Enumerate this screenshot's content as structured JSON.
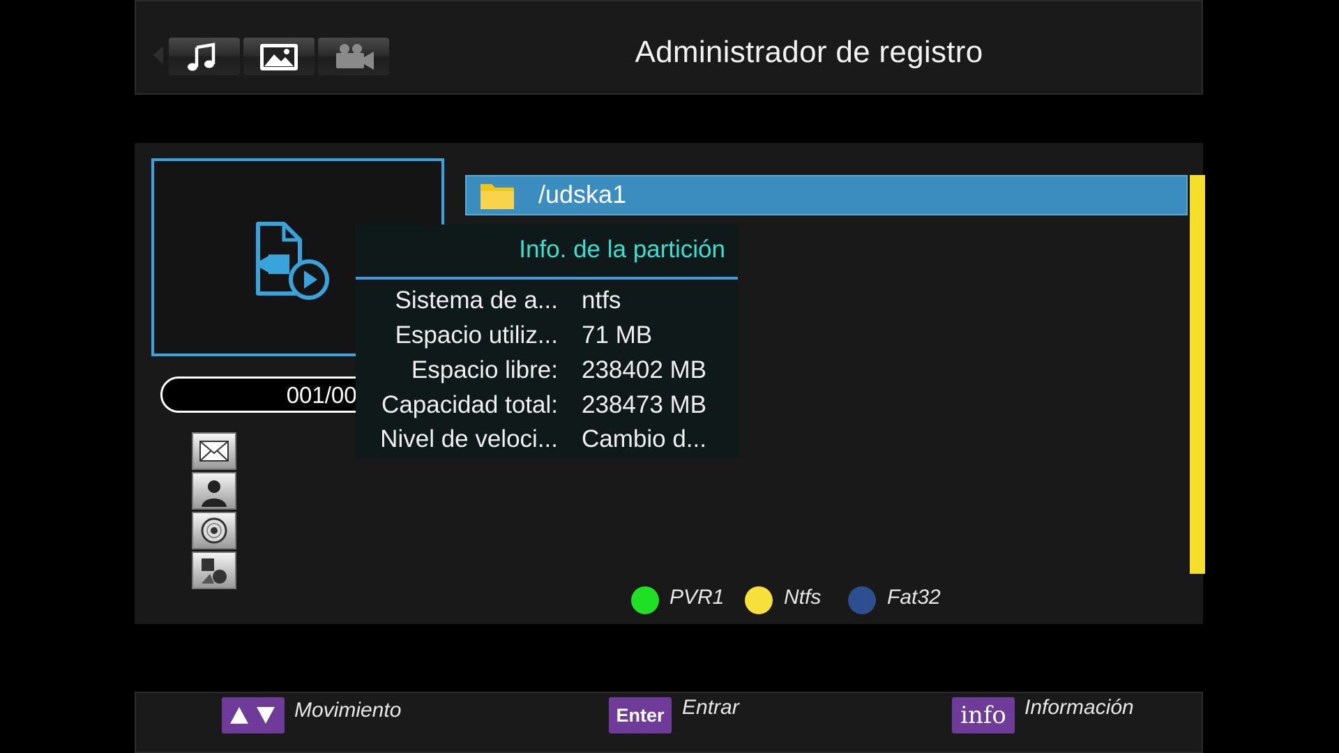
{
  "header": {
    "title": "Administrador de registro",
    "tabs": [
      {
        "name": "music",
        "icon": "music-note-icon"
      },
      {
        "name": "photo",
        "icon": "image-icon"
      },
      {
        "name": "video",
        "icon": "video-camera-icon"
      }
    ]
  },
  "preview": {
    "icon": "video-file-icon",
    "counter": "001/001"
  },
  "side_icons": [
    "mail-icon",
    "person-icon",
    "disc-icon",
    "shapes-icon"
  ],
  "file_list": {
    "items": [
      {
        "name": "/udska1",
        "icon": "folder-icon",
        "selected": true
      }
    ]
  },
  "partition_info": {
    "title": "Info. de la partición",
    "rows": [
      {
        "label": "Sistema de a...",
        "value": "ntfs"
      },
      {
        "label": "Espacio utiliz...",
        "value": "71 MB"
      },
      {
        "label": "Espacio libre:",
        "value": "238402 MB"
      },
      {
        "label": "Capacidad total:",
        "value": "238473 MB"
      },
      {
        "label": "Nivel de veloci...",
        "value": "Cambio d..."
      }
    ]
  },
  "legend": [
    {
      "label": "PVR1",
      "color": "#1fe024"
    },
    {
      "label": "Ntfs",
      "color": "#f7e03a"
    },
    {
      "label": "Fat32",
      "color": "#2d4f8f"
    }
  ],
  "footer": {
    "move": {
      "key_icon": "up-down-arrows-icon",
      "label": "Movimiento"
    },
    "enter": {
      "key": "Enter",
      "label": "Entrar"
    },
    "info": {
      "key": "info",
      "label": "Información"
    }
  },
  "colors": {
    "accent_blue": "#3b8dc0",
    "scrollbar_yellow": "#f6df2b",
    "popup_title": "#38e0d3",
    "key_purple": "#6e3b98"
  }
}
